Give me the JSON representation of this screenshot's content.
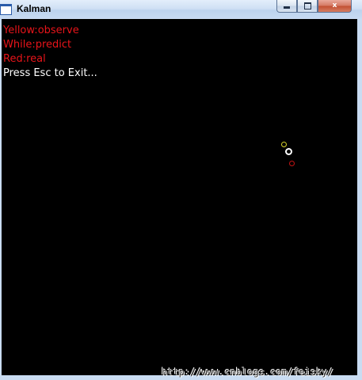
{
  "window": {
    "title": "Kalman",
    "controls": {
      "minimize_icon": "minimize-icon",
      "maximize_icon": "maximize-icon",
      "close_icon": "close-icon",
      "close_glyph": "x"
    }
  },
  "canvas": {
    "background": "#000000",
    "legend": {
      "observe": "Yellow:observe",
      "predict": "While:predict",
      "real": "Red:real",
      "exit_hint": "Press Esc to Exit..."
    },
    "markers": [
      {
        "name": "observed-position-marker",
        "color": "#d7d22a"
      },
      {
        "name": "predicted-position-marker",
        "color": "#ffffff"
      },
      {
        "name": "real-position-marker",
        "color": "#c41414"
      }
    ]
  },
  "watermark": "http://www.cnblogs.com/feisky/"
}
